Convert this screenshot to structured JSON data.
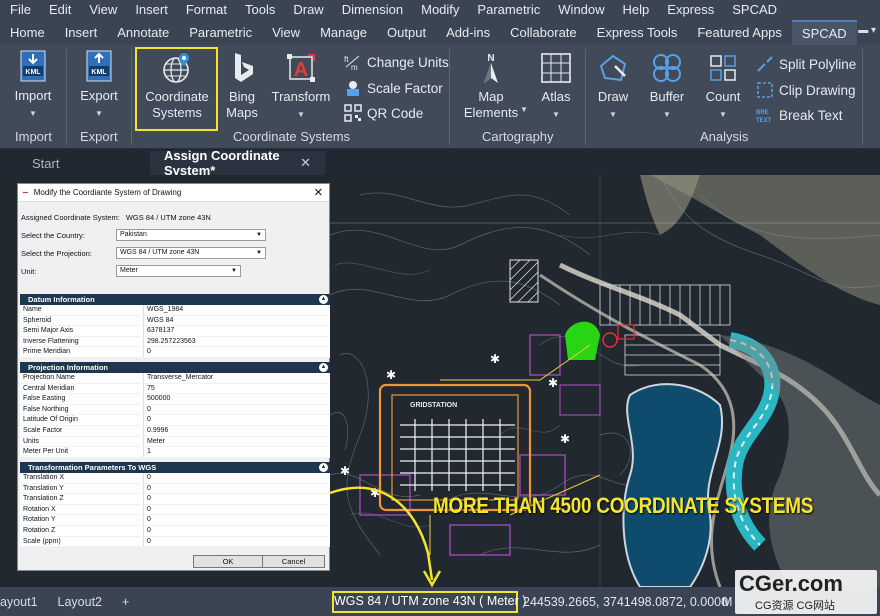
{
  "menu": [
    "File",
    "Edit",
    "View",
    "Insert",
    "Format",
    "Tools",
    "Draw",
    "Dimension",
    "Modify",
    "Parametric",
    "Window",
    "Help",
    "Express",
    "SPCAD"
  ],
  "tabs": [
    "Home",
    "Insert",
    "Annotate",
    "Parametric",
    "View",
    "Manage",
    "Output",
    "Add-ins",
    "Collaborate",
    "Express Tools",
    "Featured Apps",
    "SPCAD"
  ],
  "active_tab": "SPCAD",
  "ribbon": {
    "import_label": "Import",
    "export_label": "Export",
    "kml_badge": "KML",
    "coordinate_systems_label": "Coordinate\nSystems",
    "bing_maps_label": "Bing\nMaps",
    "transform_label": "Transform",
    "change_units_label": "Change Units",
    "scale_factor_label": "Scale Factor",
    "qr_code_label": "QR  Code",
    "map_elements_label": "Map\nElements",
    "atlas_label": "Atlas",
    "draw_label": "Draw",
    "buffer_label": "Buffer",
    "count_label": "Count",
    "split_polyline_label": "Split Polyline",
    "clip_drawing_label": "Clip Drawing",
    "break_text_label": "Break Text",
    "panel_import": "Import",
    "panel_export": "Export",
    "panel_coordinate_systems": "Coordinate Systems",
    "panel_cartography": "Cartography",
    "panel_analysis": "Analysis"
  },
  "doc_tabs": {
    "start": "Start",
    "active": "Assign Coordinate System*"
  },
  "dialog": {
    "title": "Modify the Coordiante System of Drawing",
    "assigned_label": "Assigned Coordinate System:",
    "assigned_value": "WGS 84 / UTM zone 43N",
    "country_label": "Select the Country:",
    "country_value": "Pakistan",
    "projection_label": "Select the Projection:",
    "projection_value": "WGS 84 / UTM zone 43N",
    "unit_label": "Unit:",
    "unit_value": "Meter",
    "datum_header": "Datum Information",
    "datum_rows": [
      {
        "k": "Name",
        "v": "WGS_1984"
      },
      {
        "k": "Spheroid",
        "v": "WGS 84"
      },
      {
        "k": "Semi Major Axis",
        "v": "6378137"
      },
      {
        "k": "Inverse Flattening",
        "v": "298.257223563"
      },
      {
        "k": "Prime Meridian",
        "v": "0"
      }
    ],
    "projection_header": "Projection Information",
    "projection_rows": [
      {
        "k": "Projection Name",
        "v": "Transverse_Mercator"
      },
      {
        "k": "Central Meridian",
        "v": "75"
      },
      {
        "k": "False Easting",
        "v": "500000"
      },
      {
        "k": "False Northing",
        "v": "0"
      },
      {
        "k": "Latitude Of Origin",
        "v": "0"
      },
      {
        "k": "Scale Factor",
        "v": "0.9996"
      },
      {
        "k": "Units",
        "v": "Meter"
      },
      {
        "k": "Meter Per Unit",
        "v": "1"
      }
    ],
    "transform_header": "Transformation Parameters To WGS",
    "transform_rows": [
      {
        "k": "Translation X",
        "v": "0"
      },
      {
        "k": "Translation Y",
        "v": "0"
      },
      {
        "k": "Translation Z",
        "v": "0"
      },
      {
        "k": "Rotation X",
        "v": "0"
      },
      {
        "k": "Rotation Y",
        "v": "0"
      },
      {
        "k": "Rotation Z",
        "v": "0"
      },
      {
        "k": "Scale (ppm)",
        "v": "0"
      }
    ],
    "ok_label": "OK",
    "cancel_label": "Cancel"
  },
  "canvas_labels": {
    "gridstation": "GRIDSTATION"
  },
  "banner": "MORE THAN 4500 COORDINATE SYSTEMS",
  "layouts": [
    "ayout1",
    "Layout2",
    "+"
  ],
  "status": {
    "coordinate_system": "WGS 84 / UTM zone 43N ( Meter )",
    "coordinates": "244539.2665, 3741498.0872, 0.0000",
    "model": "M"
  },
  "watermark": {
    "big": "CGer.com",
    "small": "CG资源 CG网站"
  },
  "colors": {
    "highlight": "#f2e42b",
    "banner": "#f5e532",
    "ribbon": "#404a59",
    "dialog_header": "#1f3651"
  }
}
